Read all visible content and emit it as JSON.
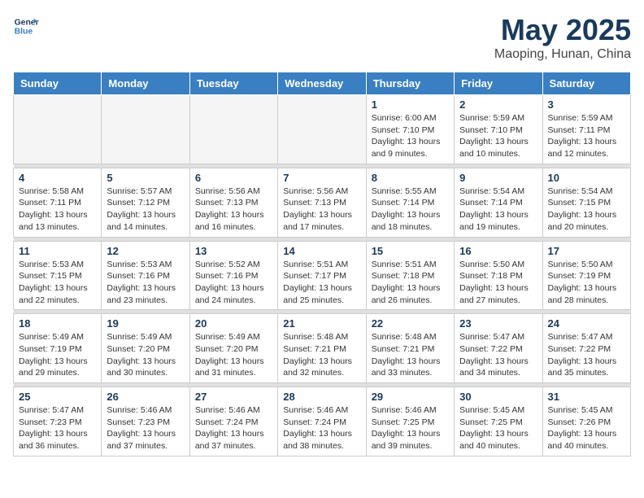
{
  "header": {
    "logo_line1": "General",
    "logo_line2": "Blue",
    "month_title": "May 2025",
    "location": "Maoping, Hunan, China"
  },
  "weekdays": [
    "Sunday",
    "Monday",
    "Tuesday",
    "Wednesday",
    "Thursday",
    "Friday",
    "Saturday"
  ],
  "weeks": [
    [
      {
        "day": "",
        "info": ""
      },
      {
        "day": "",
        "info": ""
      },
      {
        "day": "",
        "info": ""
      },
      {
        "day": "",
        "info": ""
      },
      {
        "day": "1",
        "info": "Sunrise: 6:00 AM\nSunset: 7:10 PM\nDaylight: 13 hours\nand 9 minutes."
      },
      {
        "day": "2",
        "info": "Sunrise: 5:59 AM\nSunset: 7:10 PM\nDaylight: 13 hours\nand 10 minutes."
      },
      {
        "day": "3",
        "info": "Sunrise: 5:59 AM\nSunset: 7:11 PM\nDaylight: 13 hours\nand 12 minutes."
      }
    ],
    [
      {
        "day": "4",
        "info": "Sunrise: 5:58 AM\nSunset: 7:11 PM\nDaylight: 13 hours\nand 13 minutes."
      },
      {
        "day": "5",
        "info": "Sunrise: 5:57 AM\nSunset: 7:12 PM\nDaylight: 13 hours\nand 14 minutes."
      },
      {
        "day": "6",
        "info": "Sunrise: 5:56 AM\nSunset: 7:13 PM\nDaylight: 13 hours\nand 16 minutes."
      },
      {
        "day": "7",
        "info": "Sunrise: 5:56 AM\nSunset: 7:13 PM\nDaylight: 13 hours\nand 17 minutes."
      },
      {
        "day": "8",
        "info": "Sunrise: 5:55 AM\nSunset: 7:14 PM\nDaylight: 13 hours\nand 18 minutes."
      },
      {
        "day": "9",
        "info": "Sunrise: 5:54 AM\nSunset: 7:14 PM\nDaylight: 13 hours\nand 19 minutes."
      },
      {
        "day": "10",
        "info": "Sunrise: 5:54 AM\nSunset: 7:15 PM\nDaylight: 13 hours\nand 20 minutes."
      }
    ],
    [
      {
        "day": "11",
        "info": "Sunrise: 5:53 AM\nSunset: 7:15 PM\nDaylight: 13 hours\nand 22 minutes."
      },
      {
        "day": "12",
        "info": "Sunrise: 5:53 AM\nSunset: 7:16 PM\nDaylight: 13 hours\nand 23 minutes."
      },
      {
        "day": "13",
        "info": "Sunrise: 5:52 AM\nSunset: 7:16 PM\nDaylight: 13 hours\nand 24 minutes."
      },
      {
        "day": "14",
        "info": "Sunrise: 5:51 AM\nSunset: 7:17 PM\nDaylight: 13 hours\nand 25 minutes."
      },
      {
        "day": "15",
        "info": "Sunrise: 5:51 AM\nSunset: 7:18 PM\nDaylight: 13 hours\nand 26 minutes."
      },
      {
        "day": "16",
        "info": "Sunrise: 5:50 AM\nSunset: 7:18 PM\nDaylight: 13 hours\nand 27 minutes."
      },
      {
        "day": "17",
        "info": "Sunrise: 5:50 AM\nSunset: 7:19 PM\nDaylight: 13 hours\nand 28 minutes."
      }
    ],
    [
      {
        "day": "18",
        "info": "Sunrise: 5:49 AM\nSunset: 7:19 PM\nDaylight: 13 hours\nand 29 minutes."
      },
      {
        "day": "19",
        "info": "Sunrise: 5:49 AM\nSunset: 7:20 PM\nDaylight: 13 hours\nand 30 minutes."
      },
      {
        "day": "20",
        "info": "Sunrise: 5:49 AM\nSunset: 7:20 PM\nDaylight: 13 hours\nand 31 minutes."
      },
      {
        "day": "21",
        "info": "Sunrise: 5:48 AM\nSunset: 7:21 PM\nDaylight: 13 hours\nand 32 minutes."
      },
      {
        "day": "22",
        "info": "Sunrise: 5:48 AM\nSunset: 7:21 PM\nDaylight: 13 hours\nand 33 minutes."
      },
      {
        "day": "23",
        "info": "Sunrise: 5:47 AM\nSunset: 7:22 PM\nDaylight: 13 hours\nand 34 minutes."
      },
      {
        "day": "24",
        "info": "Sunrise: 5:47 AM\nSunset: 7:22 PM\nDaylight: 13 hours\nand 35 minutes."
      }
    ],
    [
      {
        "day": "25",
        "info": "Sunrise: 5:47 AM\nSunset: 7:23 PM\nDaylight: 13 hours\nand 36 minutes."
      },
      {
        "day": "26",
        "info": "Sunrise: 5:46 AM\nSunset: 7:23 PM\nDaylight: 13 hours\nand 37 minutes."
      },
      {
        "day": "27",
        "info": "Sunrise: 5:46 AM\nSunset: 7:24 PM\nDaylight: 13 hours\nand 37 minutes."
      },
      {
        "day": "28",
        "info": "Sunrise: 5:46 AM\nSunset: 7:24 PM\nDaylight: 13 hours\nand 38 minutes."
      },
      {
        "day": "29",
        "info": "Sunrise: 5:46 AM\nSunset: 7:25 PM\nDaylight: 13 hours\nand 39 minutes."
      },
      {
        "day": "30",
        "info": "Sunrise: 5:45 AM\nSunset: 7:25 PM\nDaylight: 13 hours\nand 40 minutes."
      },
      {
        "day": "31",
        "info": "Sunrise: 5:45 AM\nSunset: 7:26 PM\nDaylight: 13 hours\nand 40 minutes."
      }
    ]
  ]
}
